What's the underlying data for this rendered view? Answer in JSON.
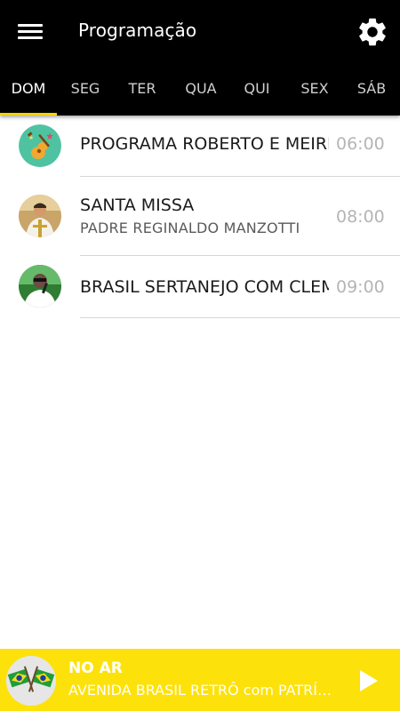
{
  "appbar": {
    "title": "Programação",
    "menu_icon": "menu-icon",
    "settings_icon": "gear-icon"
  },
  "tabs": [
    {
      "label": "DOM",
      "active": true
    },
    {
      "label": "SEG",
      "active": false
    },
    {
      "label": "TER",
      "active": false
    },
    {
      "label": "QUA",
      "active": false
    },
    {
      "label": "QUI",
      "active": false
    },
    {
      "label": "SEX",
      "active": false
    },
    {
      "label": "SÁB",
      "active": false
    }
  ],
  "schedule": [
    {
      "title": "PROGRAMA ROBERTO E MEIRI",
      "subtitle": "",
      "time": "06:00",
      "icon": "guitar-icon"
    },
    {
      "title": "SANTA MISSA",
      "subtitle": "PADRE REGINALDO MANZOTTI",
      "time": "08:00",
      "icon": "priest-avatar"
    },
    {
      "title": "BRASIL SERTANEJO COM CLEMENTE",
      "subtitle": "",
      "time": "09:00",
      "icon": "host-avatar"
    }
  ],
  "player": {
    "label": "NO AR",
    "track": "AVENIDA BRASIL RETRÔ com PATRÍCIA",
    "icon": "brazil-flags-icon",
    "play_icon": "play-icon"
  },
  "colors": {
    "appbar": "#000000",
    "accent": "#f5d400",
    "player_bg": "#fde10a",
    "time_text": "#b5b5b5"
  }
}
